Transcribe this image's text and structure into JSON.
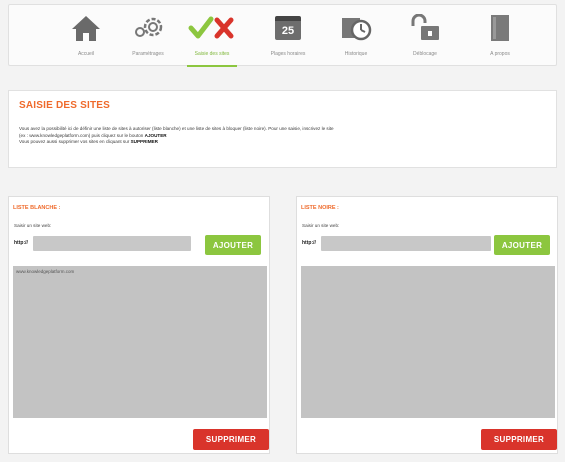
{
  "toolbar": {
    "items": [
      {
        "label": "Accueil",
        "icon": "home-icon"
      },
      {
        "label": "Paramétrages",
        "icon": "settings-icon"
      },
      {
        "label": "Saisie des sites",
        "icon": "check-cross-icon"
      },
      {
        "label": "Plages horaires",
        "icon": "calendar-icon",
        "number": "25"
      },
      {
        "label": "Historique",
        "icon": "history-icon"
      },
      {
        "label": "Déblocage",
        "icon": "unlock-icon"
      },
      {
        "label": "A propos",
        "icon": "book-icon"
      }
    ],
    "active_index": 2
  },
  "info": {
    "title": "SAISIE DES SITES",
    "line1": "Vous avez la possibilité ici de définir une liste de sites à autoriser (liste blanche) et une liste de sites à bloquer (liste noire). Pour une saisie, inscrivez le site",
    "line2_prefix": "(ex : www.knowledgeplatform.com) puis cliquez sur le bouton",
    "line2_action": "AJOUTER",
    "line3_prefix": "Vous pouvez aussi supprimer vos sites en cliquant sur",
    "line3_action": "SUPPRIMER"
  },
  "whitelist": {
    "title": "LISTE BLANCHE :",
    "hint": "Saisir un site web:",
    "field_label": "http://",
    "input_value": "",
    "add_label": "AJOUTER",
    "delete_label": "SUPPRIMER",
    "items": [
      "www.knowledgeplatform.com"
    ]
  },
  "blacklist": {
    "title": "LISTE NOIRE :",
    "hint": "Saisir un site web:",
    "field_label": "http://",
    "input_value": "",
    "add_label": "AJOUTER",
    "delete_label": "SUPPRIMER",
    "items": []
  },
  "colors": {
    "accent": "#ef6a2b",
    "add_button": "#8cc63f",
    "delete_button": "#d9342b",
    "list_bg": "#c3c3c3"
  }
}
